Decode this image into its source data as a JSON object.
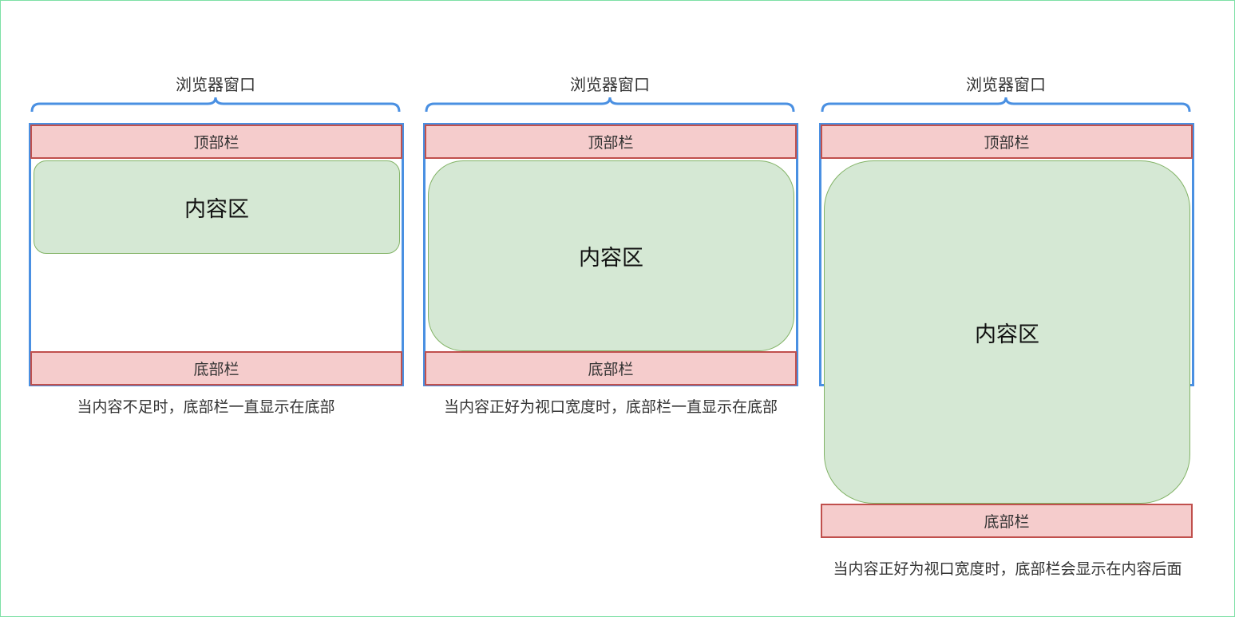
{
  "diagrams": [
    {
      "browser_label": "浏览器窗口",
      "header_label": "顶部栏",
      "content_label": "内容区",
      "footer_label": "底部栏",
      "description": "当内容不足时，底部栏一直显示在底部"
    },
    {
      "browser_label": "浏览器窗口",
      "header_label": "顶部栏",
      "content_label": "内容区",
      "footer_label": "底部栏",
      "description": "当内容正好为视口宽度时，底部栏一直显示在底部"
    },
    {
      "browser_label": "浏览器窗口",
      "header_label": "顶部栏",
      "content_label": "内容区",
      "footer_label": "底部栏",
      "description": "当内容正好为视口宽度时，底部栏会显示在内容后面"
    }
  ],
  "colors": {
    "window_border": "#4a90e2",
    "bar_fill": "#f5cccc",
    "bar_border": "#c0504d",
    "content_fill": "#d5e8d4",
    "content_border": "#82b366",
    "page_border": "#7ee0a6"
  }
}
